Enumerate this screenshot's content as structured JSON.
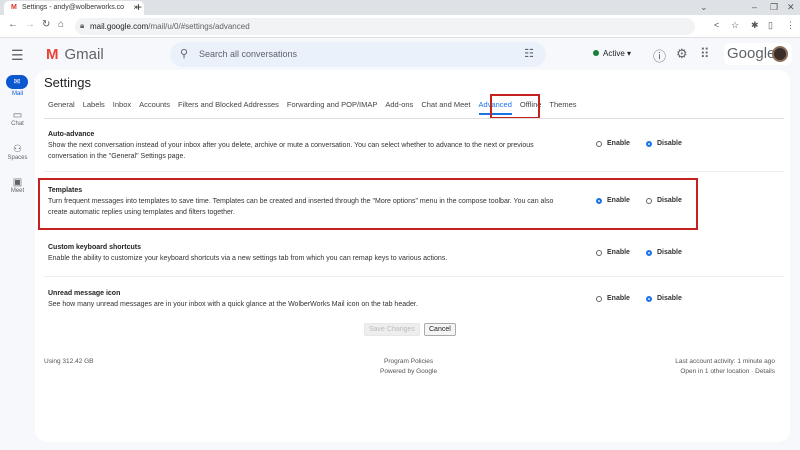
{
  "browser": {
    "tab_title": "Settings - andy@wolberworks.co",
    "url_host": "mail.google.com",
    "url_path": "/mail/u/0/#settings/advanced"
  },
  "header": {
    "app": "Gmail",
    "search_placeholder": "Search all conversations",
    "status": "Active",
    "brand": "Google"
  },
  "rail": [
    {
      "label": "Mail"
    },
    {
      "label": "Chat"
    },
    {
      "label": "Spaces"
    },
    {
      "label": "Meet"
    }
  ],
  "page_title": "Settings",
  "tabs": [
    "General",
    "Labels",
    "Inbox",
    "Accounts",
    "Filters and Blocked Addresses",
    "Forwarding and POP/IMAP",
    "Add-ons",
    "Chat and Meet",
    "Advanced",
    "Offline",
    "Themes"
  ],
  "sections": [
    {
      "title": "Auto-advance",
      "desc": "Show the next conversation instead of your inbox after you delete, archive or mute a conversation. You can select whether to advance to the next or previous conversation in the \"General\" Settings page.",
      "enable": "Enable",
      "disable": "Disable",
      "selected": "disable"
    },
    {
      "title": "Templates",
      "desc": "Turn frequent messages into templates to save time. Templates can be created and inserted through the \"More options\" menu in the compose toolbar. You can also create automatic replies using templates and filters together.",
      "enable": "Enable",
      "disable": "Disable",
      "selected": "enable"
    },
    {
      "title": "Custom keyboard shortcuts",
      "desc": "Enable the ability to customize your keyboard shortcuts via a new settings tab from which you can remap keys to various actions.",
      "enable": "Enable",
      "disable": "Disable",
      "selected": "disable"
    },
    {
      "title": "Unread message icon",
      "desc": "See how many unread messages are in your inbox with a quick glance at the WolberWorks Mail icon on the tab header.",
      "enable": "Enable",
      "disable": "Disable",
      "selected": "disable"
    }
  ],
  "buttons": {
    "save": "Save Changes",
    "cancel": "Cancel"
  },
  "footer": {
    "storage": "Using 312.42 GB",
    "policies": "Program Policies",
    "powered": "Powered by Google",
    "activity": "Last account activity: 1 minute ago",
    "location": "Open in 1 other location · Details"
  }
}
